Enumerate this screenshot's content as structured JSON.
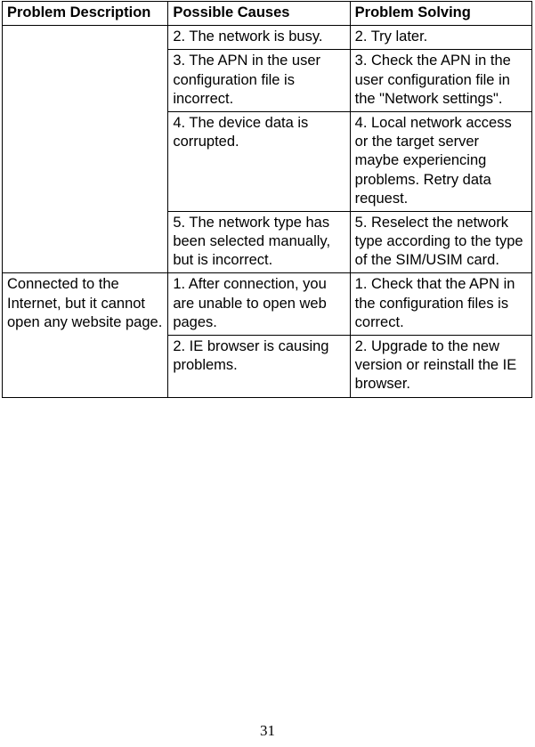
{
  "document": {
    "page_number": "31"
  },
  "table": {
    "headers": {
      "description": "Problem Description",
      "causes": "Possible Causes",
      "solving": "Problem Solving"
    },
    "rows": [
      {
        "description": "",
        "description_empty": true,
        "cause": "2. The network is busy.",
        "solution": "2. Try later."
      },
      {
        "cause": "3. The APN in the user configuration file is incorrect.",
        "solution": "3. Check the APN in the user configuration file in the \"Network settings\"."
      },
      {
        "cause": "4. The device data is corrupted.",
        "solution": "4. Local network access or the target server maybe experiencing problems. Retry data request."
      },
      {
        "cause": "5. The network type has been selected manually, but is incorrect.",
        "solution": "5. Reselect the network type according to the type of the SIM/USIM card."
      },
      {
        "description": "Connected to the Internet, but it cannot open any website page.",
        "cause": "1. After connection, you are unable to open web pages.",
        "solution": "1. Check that the APN in the configuration files is correct."
      },
      {
        "cause": "2. IE browser is causing problems.",
        "solution": "2. Upgrade to the new version or reinstall the IE browser."
      }
    ]
  }
}
